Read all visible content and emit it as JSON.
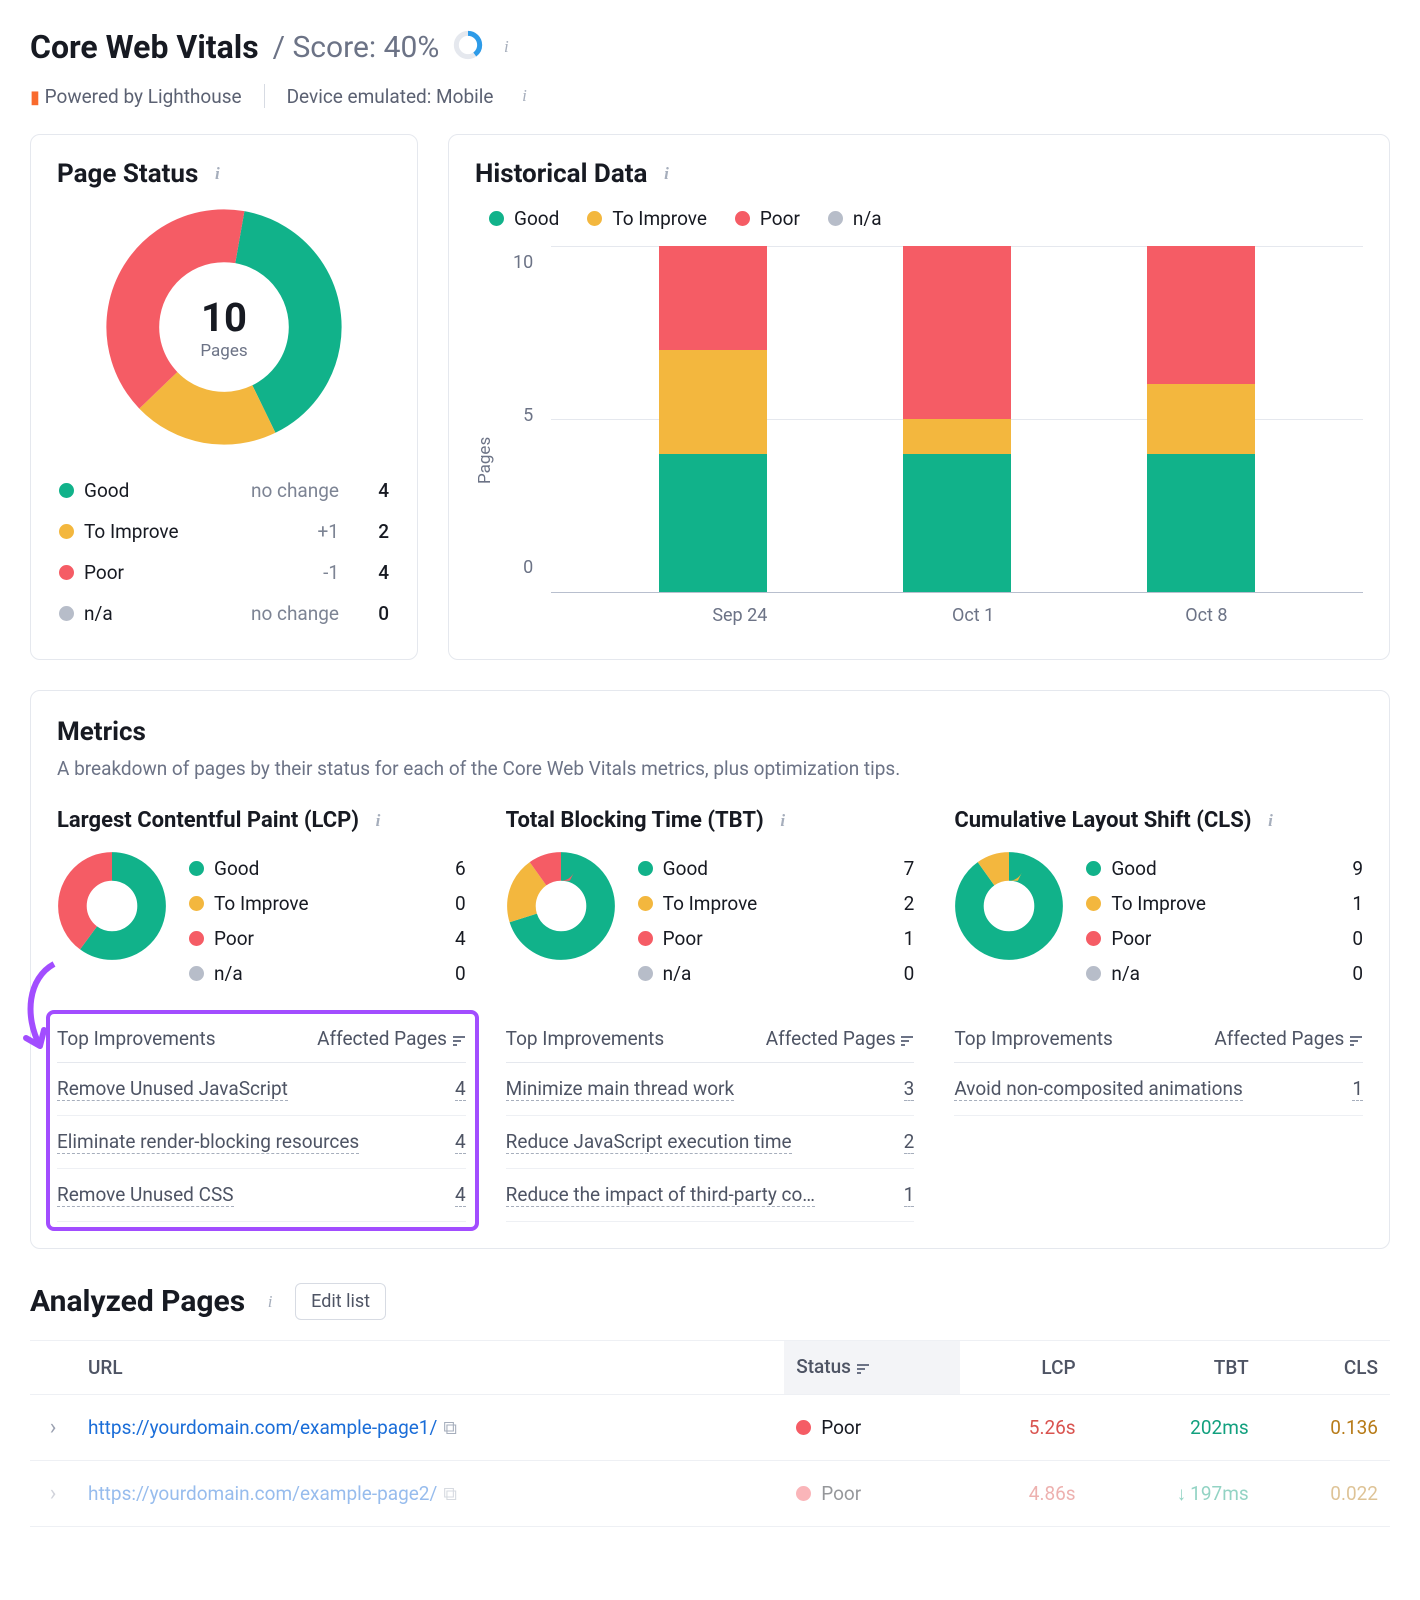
{
  "header": {
    "title": "Core Web Vitals",
    "score_prefix": "/ Score:",
    "score": "40%",
    "powered": "Powered by Lighthouse",
    "device": "Device emulated: Mobile"
  },
  "colors": {
    "good": "#11b28a",
    "improve": "#f3b73e",
    "poor": "#f55c65",
    "na": "#b7bdc9"
  },
  "page_status": {
    "title": "Page Status",
    "total": "10",
    "total_label": "Pages",
    "rows": [
      {
        "label": "Good",
        "change": "no change",
        "value": "4",
        "color": "good"
      },
      {
        "label": "To Improve",
        "change": "+1",
        "value": "2",
        "color": "improve"
      },
      {
        "label": "Poor",
        "change": "-1",
        "value": "4",
        "color": "poor"
      },
      {
        "label": "n/a",
        "change": "no change",
        "value": "0",
        "color": "na"
      }
    ]
  },
  "historical": {
    "title": "Historical Data",
    "legend": [
      "Good",
      "To Improve",
      "Poor",
      "n/a"
    ],
    "ylabel": "Pages",
    "yticks": [
      "10",
      "5",
      "0"
    ],
    "categories": [
      "Sep 24",
      "Oct 1",
      "Oct 8"
    ]
  },
  "chart_data": {
    "type": "bar",
    "title": "Historical Data",
    "xlabel": "",
    "ylabel": "Pages",
    "ylim": [
      0,
      10
    ],
    "categories": [
      "Sep 24",
      "Oct 1",
      "Oct 8"
    ],
    "series": [
      {
        "name": "Good",
        "values": [
          4,
          4,
          4
        ],
        "color": "#11b28a"
      },
      {
        "name": "To Improve",
        "values": [
          3,
          1,
          2
        ],
        "color": "#f3b73e"
      },
      {
        "name": "Poor",
        "values": [
          3,
          5,
          4
        ],
        "color": "#f55c65"
      },
      {
        "name": "n/a",
        "values": [
          0,
          0,
          0
        ],
        "color": "#b7bdc9"
      }
    ]
  },
  "metrics": {
    "title": "Metrics",
    "desc": "A breakdown of pages by their status for each of the Core Web Vitals metrics, plus optimization tips.",
    "columns": [
      {
        "title": "Largest Contentful Paint (LCP)",
        "dist": {
          "Good": 6,
          "To Improve": 0,
          "Poor": 4,
          "n/a": 0
        },
        "improvements": [
          {
            "name": "Remove Unused JavaScript",
            "count": "4"
          },
          {
            "name": "Eliminate render-blocking resources",
            "count": "4"
          },
          {
            "name": "Remove Unused CSS",
            "count": "4"
          }
        ]
      },
      {
        "title": "Total Blocking Time (TBT)",
        "dist": {
          "Good": 7,
          "To Improve": 2,
          "Poor": 1,
          "n/a": 0
        },
        "improvements": [
          {
            "name": "Minimize main thread work",
            "count": "3"
          },
          {
            "name": "Reduce JavaScript execution time",
            "count": "2"
          },
          {
            "name": "Reduce the impact of third-party co…",
            "count": "1"
          }
        ]
      },
      {
        "title": "Cumulative Layout Shift (CLS)",
        "dist": {
          "Good": 9,
          "To Improve": 1,
          "Poor": 0,
          "n/a": 0
        },
        "improvements": [
          {
            "name": "Avoid non-composited animations",
            "count": "1"
          }
        ]
      }
    ],
    "imp_hdr": {
      "left": "Top Improvements",
      "right": "Affected Pages"
    }
  },
  "analyzed": {
    "title": "Analyzed Pages",
    "edit": "Edit list",
    "cols": {
      "url": "URL",
      "status": "Status",
      "lcp": "LCP",
      "tbt": "TBT",
      "cls": "CLS"
    },
    "rows": [
      {
        "url": "https://yourdomain.com/example-page1/",
        "status": "Poor",
        "status_color": "poor",
        "lcp": "5.26s",
        "tbt": "202ms",
        "tbt_trend": "",
        "cls": "0.136",
        "faded": false
      },
      {
        "url": "https://yourdomain.com/example-page2/",
        "status": "Poor",
        "status_color": "poor",
        "lcp": "4.86s",
        "tbt": "197ms",
        "tbt_trend": "down",
        "cls": "0.022",
        "faded": true
      }
    ]
  }
}
